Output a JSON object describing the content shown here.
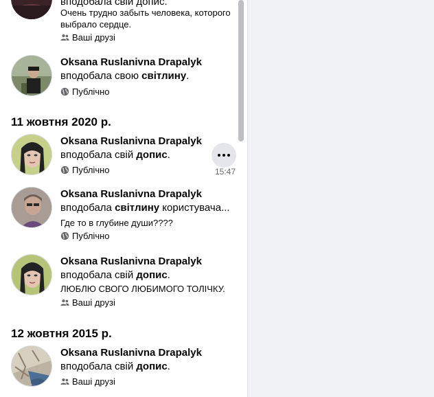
{
  "activity": {
    "partial_top": {
      "action_text": "вподобала свій допис.",
      "snippet": "Очень трудно забыть человека, которого выбрало сердце.",
      "privacy": "Ваші друзі"
    },
    "entry_1": {
      "name": "Oksana Ruslanivna Drapalyk",
      "action_prefix": "вподобала свою ",
      "action_bold": "світлину",
      "action_suffix": ".",
      "privacy": "Публічно"
    },
    "date_1": "11 жовтня 2020 р.",
    "entry_2": {
      "name": "Oksana Ruslanivna Drapalyk",
      "action_prefix": "вподобала свій ",
      "action_bold": "допис",
      "action_suffix": ".",
      "privacy": "Публічно",
      "time": "15:47"
    },
    "entry_3": {
      "name": "Oksana Ruslanivna Drapalyk",
      "action_prefix": "вподобала ",
      "action_bold": "світлину",
      "action_suffix": " користувача...",
      "snippet": "Где то в глубине души????",
      "privacy": "Публічно"
    },
    "entry_4": {
      "name": "Oksana Ruslanivna Drapalyk",
      "action_prefix": "вподобала свій ",
      "action_bold": "допис",
      "action_suffix": ".",
      "snippet": "ЛЮБЛЮ СВОГО ЛЮБИМОГО ТОЛІЧКУ.",
      "privacy": "Ваші друзі"
    },
    "date_2": "12 жовтня 2015 р.",
    "entry_5": {
      "name": "Oksana Ruslanivna Drapalyk",
      "action_prefix": "вподобала свій ",
      "action_bold": "допис",
      "action_suffix": ".",
      "privacy": "Ваші друзі"
    }
  },
  "icons": {
    "friends": "friends-icon",
    "public": "globe-icon",
    "more": "more-options-icon"
  },
  "colors": {
    "text_primary": "#050505",
    "text_secondary": "#65676b",
    "button_bg": "#e4e6eb",
    "right_bg": "#f0f2f5"
  }
}
